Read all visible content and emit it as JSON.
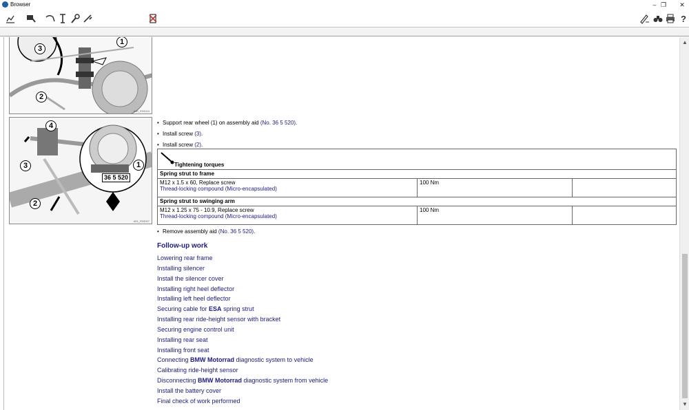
{
  "window": {
    "title": "Browser",
    "minimize": "–",
    "restore": "❐",
    "close": "✕"
  },
  "figures": {
    "fig1": {
      "code": "A50_R33024",
      "callouts": [
        "1",
        "2",
        "3"
      ]
    },
    "fig2": {
      "code": "A51_R33007",
      "callouts": [
        "1",
        "2",
        "3",
        "4"
      ],
      "tool_label": "36 5 520"
    }
  },
  "steps": [
    {
      "text": "Support rear wheel (1) on assembly aid ",
      "ref": "(No. 36 5 520)",
      "suffix": "."
    },
    {
      "text": "Install screw ",
      "ref": "(3)",
      "suffix": "."
    },
    {
      "text": "Install screw ",
      "ref": "(2)",
      "suffix": "."
    }
  ],
  "torque_table": {
    "heading": "Tightening torques",
    "sections": [
      {
        "title": "Spring strut to frame",
        "spec": "M12 x 1.5 x 60, Replace screw",
        "compound": "Thread-locking compound (Micro-encapsulated)",
        "value": "100 Nm"
      },
      {
        "title": "Spring strut to swinging arm",
        "spec": "M12 x 1.25 x 75 - 10.9, Replace screw",
        "compound": "Thread-locking compound (Micro-encapsulated)",
        "value": "100 Nm"
      }
    ]
  },
  "remove_step": {
    "text": "Remove assembly aid ",
    "ref": "(No. 36 5 520)",
    "suffix": "."
  },
  "followup": {
    "title": "Follow-up work",
    "items": [
      {
        "pre": "Lowering rear frame",
        "bold": "",
        "post": ""
      },
      {
        "pre": "Installing silencer",
        "bold": "",
        "post": ""
      },
      {
        "pre": "Install the silencer cover",
        "bold": "",
        "post": ""
      },
      {
        "pre": "Installing right heel deflector",
        "bold": "",
        "post": ""
      },
      {
        "pre": "Installing left heel deflector",
        "bold": "",
        "post": ""
      },
      {
        "pre": "Securing cable for ",
        "bold": "ESA",
        "post": " spring strut"
      },
      {
        "pre": "Installing rear ride-height sensor with bracket",
        "bold": "",
        "post": ""
      },
      {
        "pre": "Securing engine control unit",
        "bold": "",
        "post": ""
      },
      {
        "pre": "Installing rear seat",
        "bold": "",
        "post": ""
      },
      {
        "pre": "Installing front seat",
        "bold": "",
        "post": ""
      },
      {
        "pre": "Connecting ",
        "bold": "BMW Motorrad",
        "post": " diagnostic system to vehicle"
      },
      {
        "pre": "Calibrating ride-height sensor",
        "bold": "",
        "post": ""
      },
      {
        "pre": "Disconnecting ",
        "bold": "BMW Motorrad",
        "post": " diagnostic system from vehicle"
      },
      {
        "pre": "Install the battery cover",
        "bold": "",
        "post": ""
      },
      {
        "pre": "Final check of work performed",
        "bold": "",
        "post": ""
      }
    ]
  },
  "icons": {
    "toolbar_left": [
      "chart-icon",
      "tools-icon",
      "lift-icon",
      "torque-wrench-icon",
      "wrench-icon",
      "screwdriver-icon"
    ],
    "toolbar_mid": [
      "exit-icon"
    ],
    "toolbar_right": [
      "signature-icon",
      "binoculars-icon",
      "print-icon",
      "help-icon"
    ]
  }
}
